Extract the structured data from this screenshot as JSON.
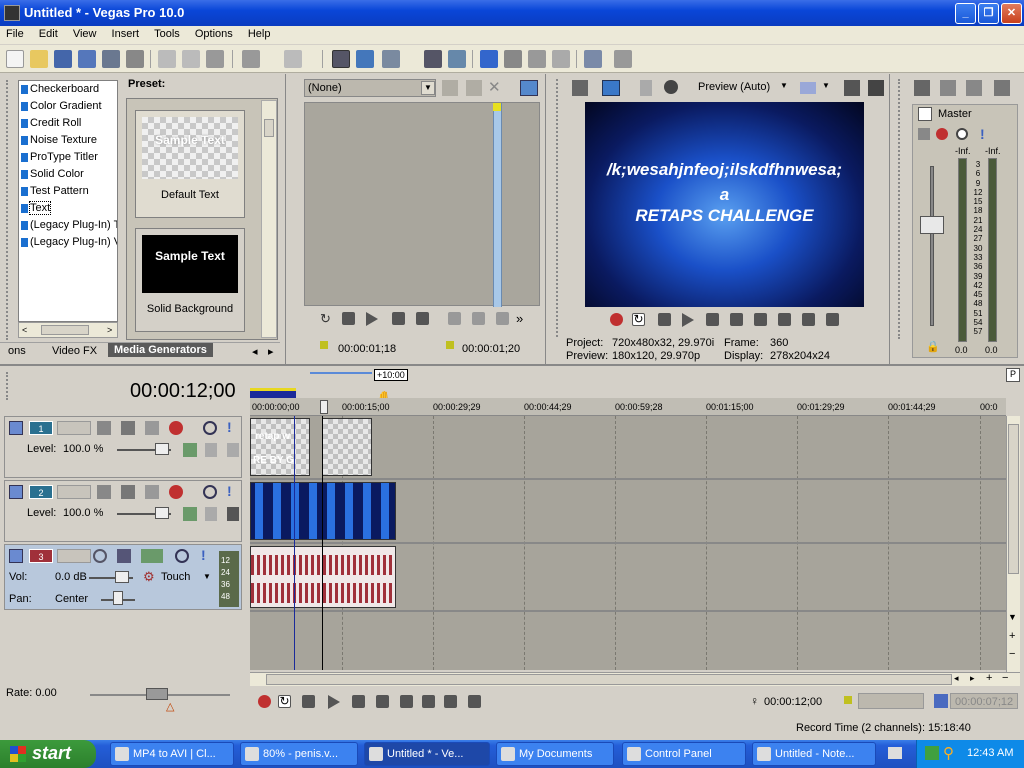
{
  "window": {
    "title": "Untitled * - Vegas Pro 10.0"
  },
  "menu": [
    "File",
    "Edit",
    "View",
    "Insert",
    "Tools",
    "Options",
    "Help"
  ],
  "generators": {
    "items": [
      "Checkerboard",
      "Color Gradient",
      "Credit Roll",
      "Noise Texture",
      "ProType Titler",
      "Solid Color",
      "Test Pattern",
      "Text",
      "(Legacy Plug-In) T",
      "(Legacy Plug-In) V"
    ],
    "selected_index": 7,
    "preset_label": "Preset:",
    "presets": [
      {
        "sample": "Sample Text",
        "name": "Default Text"
      },
      {
        "sample": "Sample Text",
        "name": "Solid Background"
      }
    ],
    "tabs": [
      "ons",
      "Video FX",
      "Media Generators"
    ],
    "active_tab": "Media Generators"
  },
  "trimmer": {
    "dropdown_value": "(None)",
    "time_in": "00:00:01;18",
    "time_out": "00:00:01;20"
  },
  "preview": {
    "mode": "Preview (Auto)",
    "overlay": {
      "line1": "/k;wesahjnfeoj;ilskdfhnwesa;",
      "line2": "a",
      "line3": "RETAPS CHALLENGE"
    },
    "project_label": "Project:",
    "project_value": "720x480x32, 29.970i",
    "frame_label": "Frame:",
    "frame_value": "360",
    "preview_label": "Preview:",
    "preview_value": "180x120, 29.970p",
    "display_label": "Display:",
    "display_value": "278x204x24"
  },
  "master": {
    "title": "Master",
    "left_top": "-Inf.",
    "right_top": "-Inf.",
    "left_bottom": "0.0",
    "right_bottom": "0.0",
    "scale": [
      "3",
      "6",
      "9",
      "12",
      "15",
      "18",
      "21",
      "24",
      "27",
      "30",
      "33",
      "36",
      "39",
      "42",
      "45",
      "48",
      "51",
      "54",
      "57"
    ]
  },
  "timeline": {
    "cursor_time": "00:00:12;00",
    "zoom_badge": "+10:00",
    "ruler": [
      "00:00:00;00",
      "00:00:15;00",
      "00:00:29;29",
      "00:00:44;29",
      "00:00:59;28",
      "00:01:15;00",
      "00:01:29;29",
      "00:01:44;29",
      "00:0"
    ],
    "tracks": [
      {
        "num": "1",
        "label": "Level:",
        "value": "100.0 %"
      },
      {
        "num": "2",
        "label": "Level:",
        "value": "100.0 %"
      },
      {
        "num": "3",
        "vol_label": "Vol:",
        "vol_value": "0.0 dB",
        "pan_label": "Pan:",
        "pan_value": "Center",
        "mode": "Touch",
        "meter": [
          "12",
          "24",
          "36",
          "48"
        ]
      }
    ],
    "clip_text": {
      "a": "retap w",
      "b": "RE BY G"
    },
    "rate_label": "Rate: 0.00",
    "bottom_time": "00:00:12;00",
    "bottom_time2": "00:00:07;12",
    "record_time": "Record Time (2 channels): 15:18:40"
  },
  "taskbar": {
    "start": "start",
    "items": [
      "MP4 to AVI | Cl...",
      "80% - penis.v...",
      "Untitled * - Ve...",
      "My Documents",
      "Control Panel",
      "Untitled - Note..."
    ],
    "active_index": 2,
    "clock": "12:43 AM"
  }
}
